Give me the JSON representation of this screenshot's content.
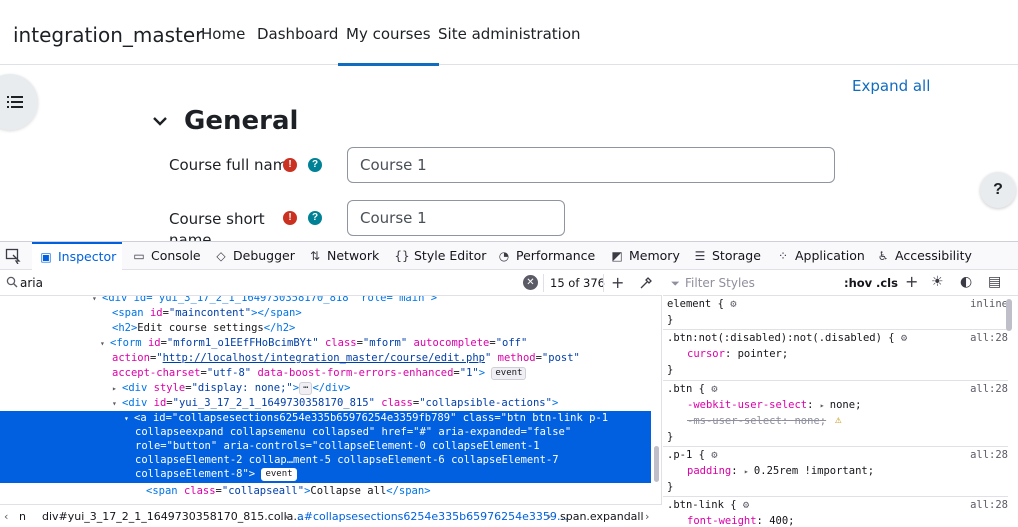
{
  "navbar": {
    "site_name": "integration_master",
    "links": [
      "Home",
      "Dashboard",
      "My courses",
      "Site administration"
    ],
    "active": "My courses"
  },
  "page": {
    "expand_all": "Expand all",
    "section_title": "General",
    "fields": [
      {
        "label": "Course full name",
        "value": "Course 1"
      },
      {
        "label": "Course short name",
        "value": "Course 1"
      }
    ],
    "help_fab": "?"
  },
  "devtools": {
    "tabs": [
      {
        "label": "Inspector",
        "icon": "inspector-icon"
      },
      {
        "label": "Console",
        "icon": "console-icon"
      },
      {
        "label": "Debugger",
        "icon": "debugger-icon"
      },
      {
        "label": "Network",
        "icon": "network-icon"
      },
      {
        "label": "Style Editor",
        "icon": "style-editor-icon"
      },
      {
        "label": "Performance",
        "icon": "performance-icon"
      },
      {
        "label": "Memory",
        "icon": "memory-icon"
      },
      {
        "label": "Storage",
        "icon": "storage-icon"
      },
      {
        "label": "Application",
        "icon": "application-icon"
      },
      {
        "label": "Accessibility",
        "icon": "accessibility-icon"
      }
    ],
    "active_tab": "Inspector",
    "search": {
      "value": "aria",
      "match_count": "15 of 376"
    },
    "markup": {
      "l1_open": "<div id=\"yui_3_17_2_1_1649730358170_818\" role=\"main\">",
      "l2_id": "maincontent",
      "l3_text": "Edit course settings",
      "form_id": "mform1_o1EEfFHoBcimBYt",
      "form_class": "mform",
      "form_autocomplete": "off",
      "form_action": "http://localhost/integration_master/course/edit.php",
      "form_method": "post",
      "form_charset": "utf-8",
      "form_boost": "1",
      "hidden_style": "display: none;",
      "div_id": "yui_3_17_2_1_1649730358170_815",
      "div_class": "collapsible-actions",
      "a_line1": "<a id=\"collapsesections6254e335b65976254e3359fb789\" class=\"btn btn-link p-1",
      "a_line2": "collapseexpand collapsemenu collapsed\" href=\"#\" aria-expanded=\"false\"",
      "a_line3": "role=\"button\" aria-controls=\"collapseElement-0 collapseElement-1",
      "a_line4": "collapseElement-2 collap…ment-5 collapseElement-6 collapseElement-7",
      "a_line5": "collapseElement-8\">",
      "span_class": "collapseall",
      "span_text": "Collapse all",
      "event_badge": "event"
    },
    "breadcrumbs": [
      "n",
      "div#yui_3_17_2_1_1649730358170_815.colla…",
      "a#collapsesections6254e335b65976254e3359…",
      "span.expandall"
    ],
    "rules": {
      "filter_placeholder": "Filter Styles",
      "hov": ":hov",
      "cls": ".cls",
      "element_selector": "element {",
      "element_source": "inline",
      "r1_selector": ".btn:not(:disabled):not(.disabled) {",
      "r1_source": "all:28",
      "r1_prop": "cursor",
      "r1_val": "pointer",
      "r2_selector": ".btn {",
      "r2_source": "all:28",
      "r2_prop1": "-webkit-user-select",
      "r2_val1": "none",
      "r2_prop2": "-ms-user-select",
      "r2_val2": "none",
      "r3_selector": ".p-1 {",
      "r3_source": "all:28",
      "r3_prop": "padding",
      "r3_val": "0.25rem !important",
      "r4_selector": ".btn-link {",
      "r4_source": "all:28",
      "r4_prop": "font-weight",
      "r4_val": "400"
    }
  }
}
